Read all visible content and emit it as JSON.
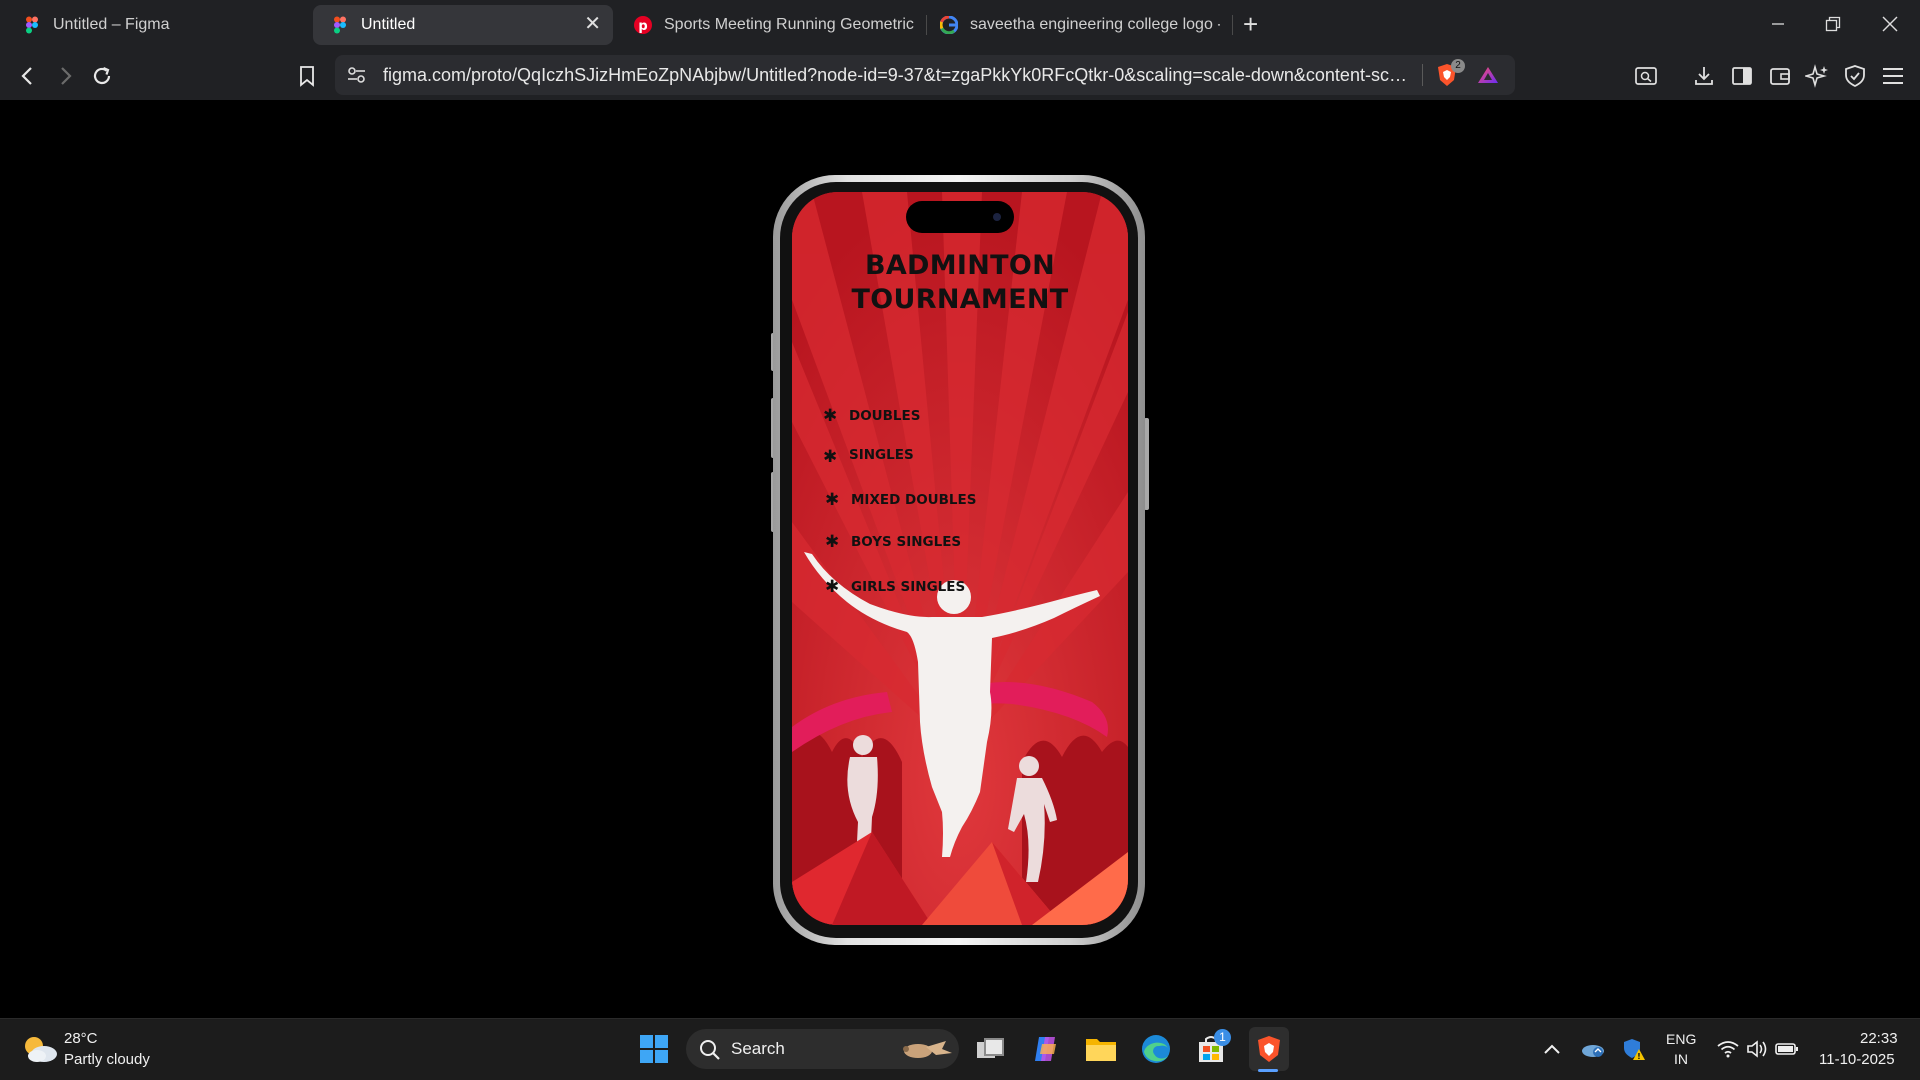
{
  "browser": {
    "tabs": [
      {
        "title": "Untitled – Figma",
        "favicon": "figma-icon",
        "active": false
      },
      {
        "title": "Untitled",
        "favicon": "figma-icon",
        "active": true
      },
      {
        "title": "Sports Meeting Running Geometric V",
        "favicon": "pinterest-icon",
        "active": false
      },
      {
        "title": "saveetha engineering college logo - G",
        "favicon": "google-icon",
        "active": false
      }
    ],
    "url": "figma.com/proto/QqIczhSJizHmEoZpNAbjbw/Untitled?node-id=9-37&t=zgaPkkYk0RFcQtkr-0&scaling=scale-down&content-scali...",
    "brave_badge_count": "2"
  },
  "poster": {
    "title_line1": "BADMINTON",
    "title_line2": "TOURNAMENT",
    "bullet_symbol": "✱",
    "events": [
      "DOUBLES",
      "SINGLES",
      "MIXED DOUBLES",
      "BOYS SINGLES",
      "GIRLS SINGLES"
    ],
    "colors": {
      "background": "#c9202a",
      "text": "#111111"
    }
  },
  "taskbar": {
    "weather_temp": "28°C",
    "weather_desc": "Partly cloudy",
    "search_label": "Search",
    "store_badge": "1",
    "lang_line1": "ENG",
    "lang_line2": "IN",
    "time": "22:33",
    "date": "11-10-2025"
  }
}
